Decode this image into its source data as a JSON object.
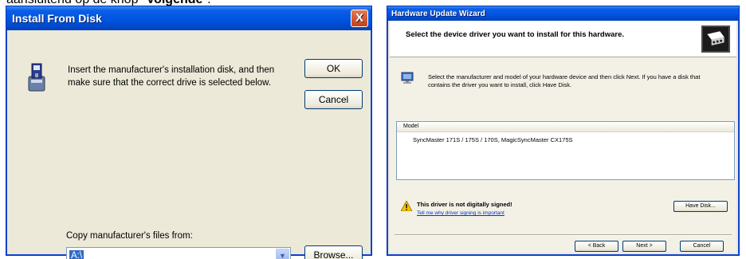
{
  "caption": {
    "text": "aansluitend op de knop \"",
    "bold": "Volgende",
    "tail": "\"."
  },
  "install_dialog": {
    "title": "Install From Disk",
    "close_glyph": "X",
    "message": "Insert the manufacturer's installation disk, and then make sure that the correct drive is selected below.",
    "ok_label": "OK",
    "cancel_label": "Cancel",
    "copy_label": "Copy manufacturer's files from:",
    "path_value": "A:\\",
    "browse_label": "Browse..."
  },
  "wizard": {
    "title": "Hardware Update Wizard",
    "header_title": "Select the device driver you want to install for this hardware.",
    "message": "Select the manufacturer and model of your hardware device and then click Next. If you have a disk that contains the driver you want to install, click Have Disk.",
    "list_header": "Model",
    "list_items": [
      "SyncMaster 171S / 175S / 170S, MagicSyncMaster CX175S"
    ],
    "warning_title": "This driver is not digitally signed!",
    "warning_link": "Tell me why driver signing is important",
    "have_disk_label": "Have Disk...",
    "back_label": "< Back",
    "next_label": "Next >",
    "cancel_label": "Cancel"
  },
  "colors": {
    "titlebar_blue": "#0054e3",
    "dialog_bg": "#ece9d8",
    "selection_blue": "#316ac5",
    "close_red": "#c83f16"
  }
}
